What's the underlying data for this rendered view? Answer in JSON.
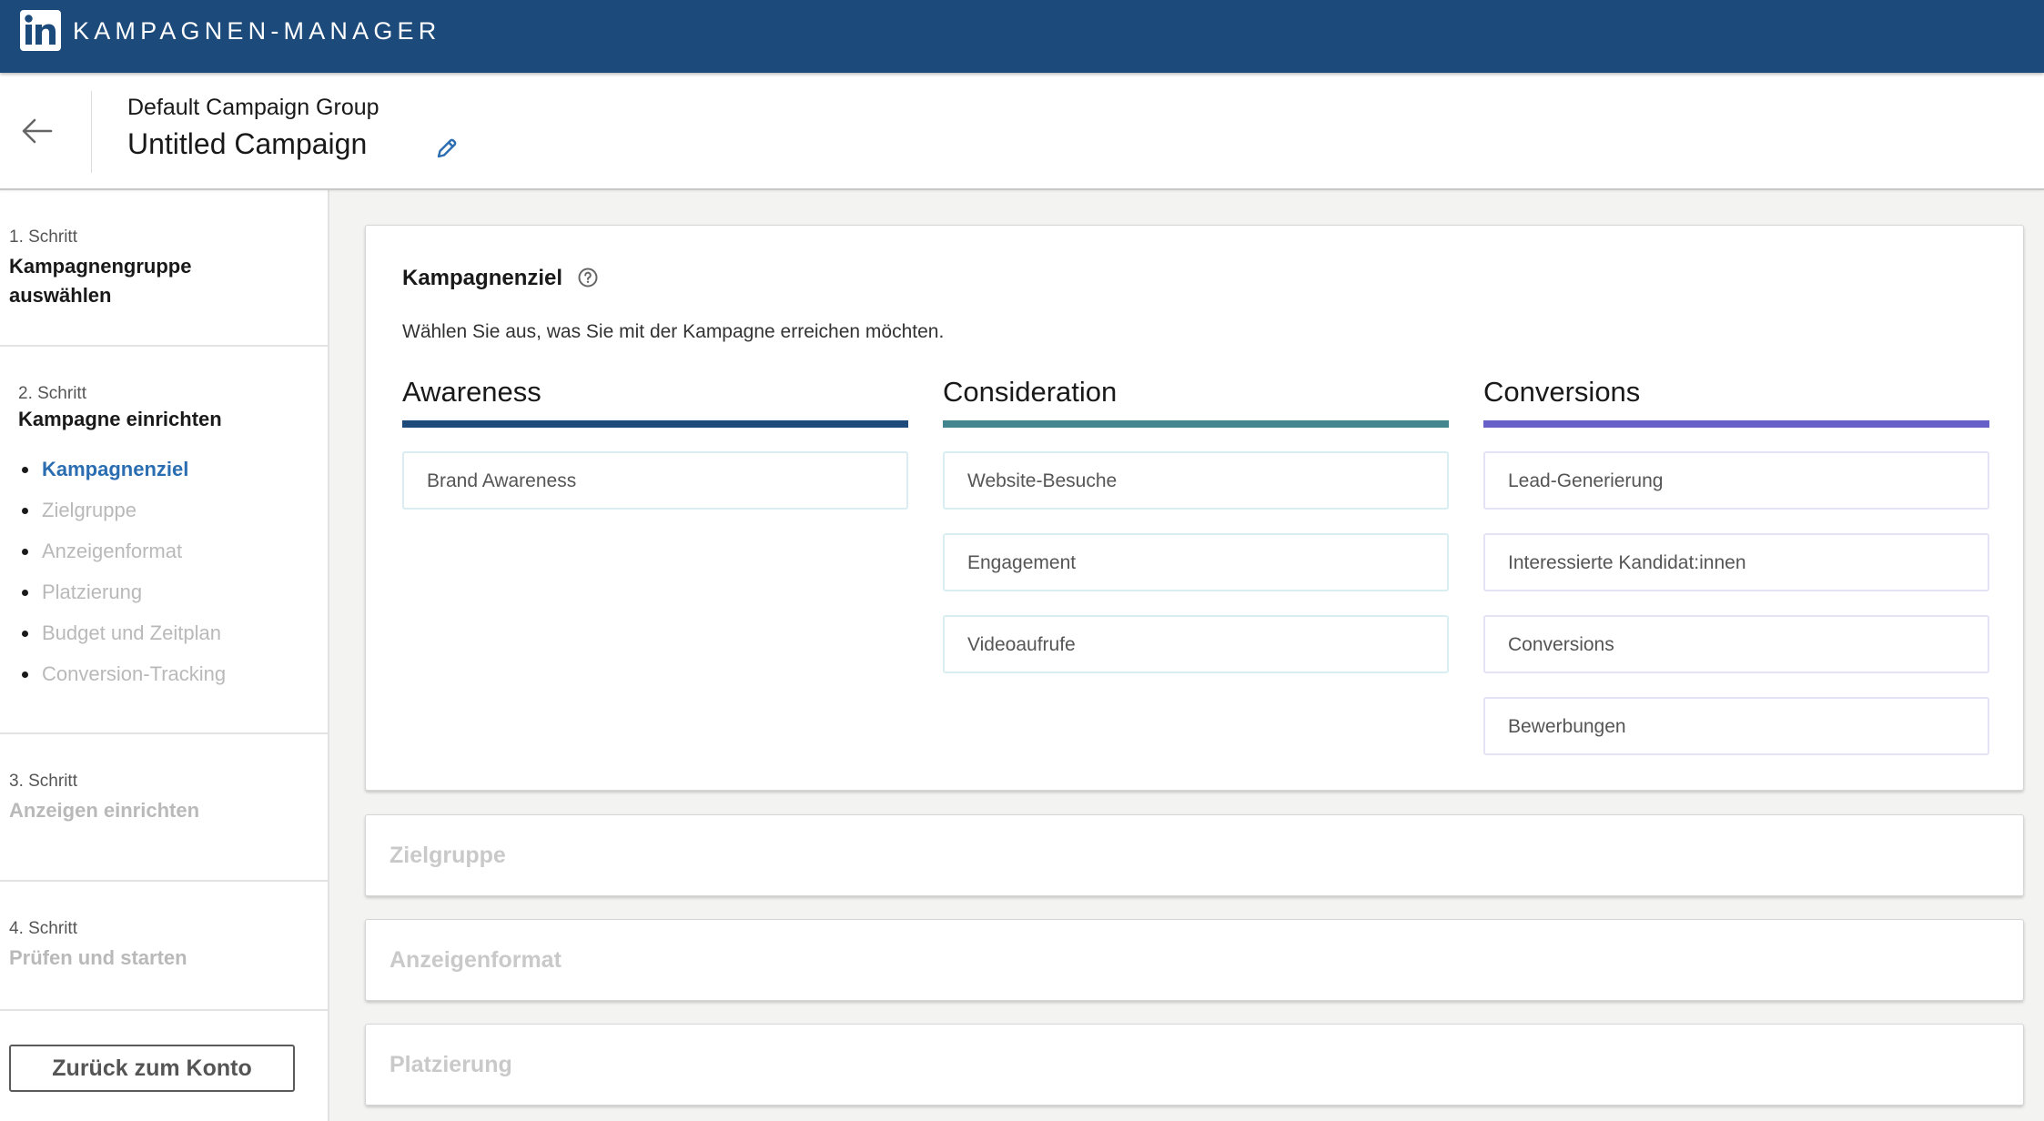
{
  "topbar": {
    "logo_text": "in",
    "app_title": "KAMPAGNEN-MANAGER",
    "brand_color": "#1c4a7a"
  },
  "subheader": {
    "back_icon": "arrow-left-icon",
    "group_name": "Default Campaign Group",
    "campaign_name": "Untitled Campaign",
    "edit_icon": "pencil-icon"
  },
  "sidebar": {
    "steps": [
      {
        "label": "1. Schritt",
        "title": "Kampagnengruppe auswählen",
        "title_line1": "Kampagnengruppe",
        "title_line2": "auswählen",
        "state": "done"
      },
      {
        "label": "2. Schritt",
        "title": "Kampagne einrichten",
        "state": "current",
        "substeps": [
          {
            "label": "Kampagnenziel",
            "active": true
          },
          {
            "label": "Zielgruppe",
            "active": false
          },
          {
            "label": "Anzeigenformat",
            "active": false
          },
          {
            "label": "Platzierung",
            "active": false
          },
          {
            "label": "Budget und Zeitplan",
            "active": false
          },
          {
            "label": "Conversion-Tracking",
            "active": false
          }
        ]
      },
      {
        "label": "3. Schritt",
        "title": "Anzeigen einrichten",
        "state": "disabled"
      },
      {
        "label": "4. Schritt",
        "title": "Prüfen und starten",
        "state": "disabled"
      }
    ],
    "back_button": "Zurück zum Konto"
  },
  "main": {
    "objective": {
      "title": "Kampagnenziel",
      "help_icon": "question-circle-icon",
      "description": "Wählen Sie aus, was Sie mit der Kampagne erreichen möchten.",
      "columns": [
        {
          "heading": "Awareness",
          "color": "#1c4a7a",
          "options": [
            "Brand Awareness"
          ]
        },
        {
          "heading": "Consideration",
          "color": "#43868f",
          "options": [
            "Website-Besuche",
            "Engagement",
            "Videoaufrufe"
          ]
        },
        {
          "heading": "Conversions",
          "color": "#6660c8",
          "options": [
            "Lead-Generierung",
            "Interessierte Kandidat:innen",
            "Conversions",
            "Bewerbungen"
          ]
        }
      ]
    },
    "collapsed_sections": [
      "Zielgruppe",
      "Anzeigenformat",
      "Platzierung"
    ]
  }
}
